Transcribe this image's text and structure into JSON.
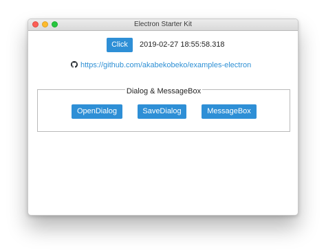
{
  "window": {
    "title": "Electron Starter Kit"
  },
  "main": {
    "click_label": "Click",
    "datetime": "2019-02-27 18:55:58.318",
    "link_icon": "github-octocat-icon",
    "link_text": "https://github.com/akabekobeko/examples-electron"
  },
  "dialog_group": {
    "legend": "Dialog & MessageBox",
    "buttons": [
      {
        "label": "OpenDialog"
      },
      {
        "label": "SaveDialog"
      },
      {
        "label": "MessageBox"
      }
    ]
  },
  "colors": {
    "button": "#2e8fd6",
    "link": "#2d8fd4",
    "close": "#fc5f57",
    "minimize": "#fdbb2d",
    "maximize": "#27c73f"
  }
}
